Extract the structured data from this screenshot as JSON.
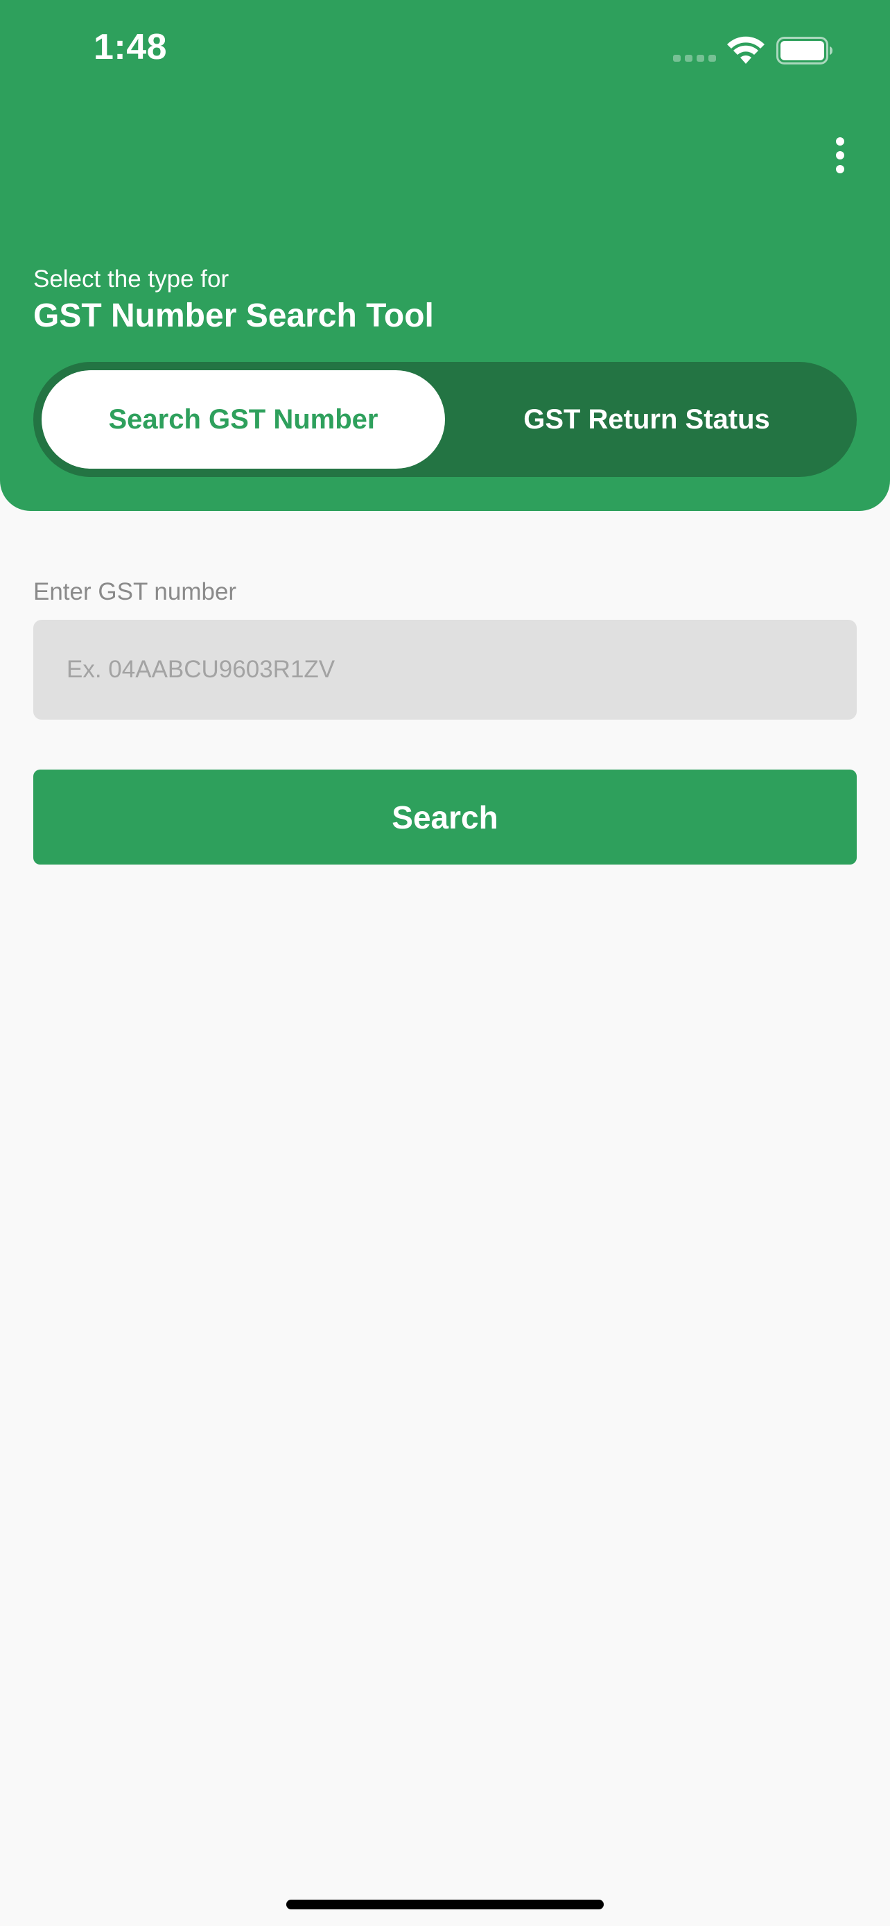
{
  "status_bar": {
    "time": "1:48"
  },
  "header": {
    "subtitle": "Select the type for",
    "title": "GST Number Search Tool",
    "menu_icon": "more-vertical-icon"
  },
  "tabs": [
    {
      "label": "Search GST Number",
      "active": true
    },
    {
      "label": "GST Return Status",
      "active": false
    }
  ],
  "form": {
    "label": "Enter GST number",
    "value": "",
    "placeholder": "Ex. 04AABCU9603R1ZV",
    "button_label": "Search"
  },
  "colors": {
    "primary": "#2ea05c",
    "primary_dark": "#237443",
    "background": "#f9f9f9",
    "input_background": "#e0e0e0"
  }
}
